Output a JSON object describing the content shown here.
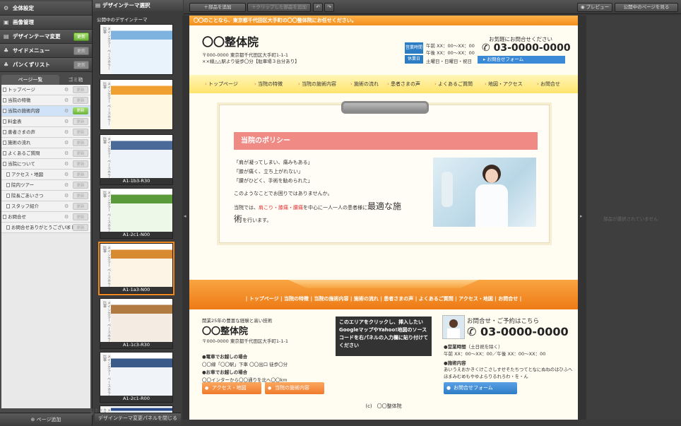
{
  "left_menu": {
    "items": [
      {
        "label": "全体設定",
        "icon": "gear-icon",
        "glyph": "⚙"
      },
      {
        "label": "画像管理",
        "icon": "image-icon",
        "glyph": "▣"
      },
      {
        "label": "デザインテーマ変更",
        "icon": "theme-icon",
        "glyph": "▤",
        "button": "更新"
      },
      {
        "label": "サイドメニュー",
        "icon": "sitemap-icon",
        "glyph": "♣"
      },
      {
        "label": "パンくずリスト",
        "icon": "breadcrumb-icon",
        "glyph": "♣"
      }
    ],
    "tabs": [
      "ページ一覧",
      "ゴミ箱"
    ],
    "update_label": "更新",
    "pages": [
      {
        "label": "トップページ"
      },
      {
        "label": "当院の特徴"
      },
      {
        "label": "当院の施術内容",
        "selected": true,
        "green": true
      },
      {
        "label": "料金表"
      },
      {
        "label": "患者さまの声"
      },
      {
        "label": "施術の流れ"
      },
      {
        "label": "よくあるご質問"
      },
      {
        "label": "当院について"
      },
      {
        "label": "アクセス・地図",
        "sub": true
      },
      {
        "label": "院内ツアー",
        "sub": true
      },
      {
        "label": "院長ごあいさつ",
        "sub": true
      },
      {
        "label": "スタッフ紹介",
        "sub": true
      },
      {
        "label": "お問合せ"
      },
      {
        "label": "お問合せありがとうございました",
        "sub": true
      }
    ],
    "add_page": "ページ追加"
  },
  "theme_panel": {
    "title": "デザインテーマ選択",
    "subtitle": "公開中のデザインテーマ",
    "themes": [
      "",
      "",
      "A1-1b3-R30",
      "A1-2c1-N00",
      "A1-1a3-N00",
      "A1-1c3-R30",
      "A1-2c1-R00",
      "A1-2c1-L30"
    ],
    "strip_words": "メインカラー ベースカラー 比率",
    "close_label": "デザインテーマ変更パネルを閉じる"
  },
  "toolbar": {
    "add_part": "＋部品を追加",
    "clip_add": "＋クリップした部品を追加",
    "undo": "↶",
    "redo": "↷",
    "preview": "◉ プレビュー",
    "view_public": "公開中のページを見る"
  },
  "site": {
    "top_banner": "〇〇のことなら、東京都千代田区大手町の〇〇整体院にお任せください。",
    "name": "〇〇整体院",
    "address": "〒000-0000 東京都千代田区大手町1-1-1",
    "access": "××線△△駅より徒歩〇分【駐車場３台分あり】",
    "hours_label": "営業時間",
    "holiday_label": "休業日",
    "hours_am": "午前 XX：00～XX：00",
    "hours_pm": "午後 XX：00～XX：00",
    "holidays": "土曜日・日曜日・祝日",
    "contact_lead": "お気軽にお問合せください",
    "phone": "03-0000-0000",
    "contact_form": "お問合せフォーム",
    "nav": [
      "トップページ",
      "当院の特徴",
      "当院の施術内容",
      "施術の流れ",
      "患者さまの声",
      "よくあるご質問",
      "地図・アクセス",
      "お問合せ"
    ],
    "policy_title": "当院のポリシー",
    "policy_lines": [
      "「肩が凝ってしまい、痛みもある」",
      "「膝が痛く、立ち上がれない」",
      "「腰がひどく、手術を勧められた」"
    ],
    "policy_q": "このようなことでお困りではありませんか。",
    "policy_a1": "当院では、",
    "policy_a_hl": "肩こり・膝痛・腰痛",
    "policy_a2": "を中心に一人一人の患者様に",
    "policy_a_big": "最適な施",
    "policy_a3": "術",
    "policy_a4": "を行います。",
    "footer_links": "| トップページ | 当院の特徴 | 当院の施術内容 | 施術の流れ | 患者さまの声 | よくあるご質問 | アクセス・地図 | お問合せ |",
    "footer_tagline": "開業25年の豊富な経験と高い技術",
    "footer_name": "〇〇整体院",
    "footer_address": "〒000-0000 東京都千代田区大手町1-1-1",
    "train_h": "●電車でお越しの場合",
    "train": "〇〇線「〇〇駅」下車 〇〇出口 徒歩〇分",
    "car_h": "●お車でお越しの場合",
    "car": "〇〇インターから〇〇通りを北へ〇〇km",
    "btn_access": "アクセス・地図",
    "btn_treatment": "当院の施術内容",
    "map_note": "このエリアをクリックし、挿入したいGoogleマップやYahoo!地図のソースコードを右パネルの入力欄に貼り付けてください",
    "reserve_lead": "お問合せ・ご予約はこちら",
    "footer_hours_h": "●営業時間",
    "footer_hours_note": "（土日祝を除く）",
    "footer_hours": "午前 XX：00～XX：00／午後 XX：00～XX：00",
    "footer_treat_h": "●施術内容",
    "footer_treat": "あいうえおかきくけこさしすせそたちつてとなにぬねのはひふへほまみむめもやゆよらりるれろわ・を・ん",
    "copyright": "(c)　〇〇整体院"
  },
  "right_panel": {
    "note": "部品が選択されていません"
  }
}
